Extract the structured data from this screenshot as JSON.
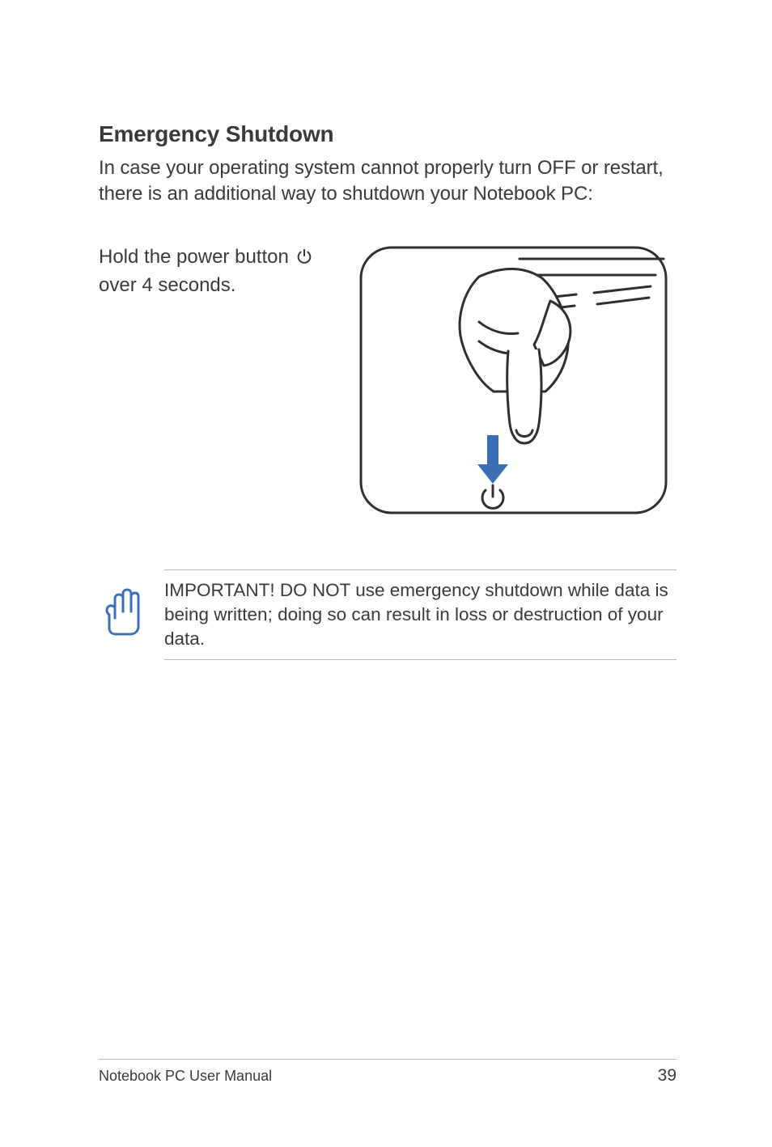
{
  "heading": "Emergency Shutdown",
  "intro": "In case your operating system cannot properly turn OFF or restart, there is an additional way to shutdown your Notebook PC:",
  "instruction_pre": "Hold the power button ",
  "instruction_post": " over 4 seconds.",
  "note": "IMPORTANT!  DO NOT use emergency shutdown while data is being written; doing so can result in loss or destruction of your data.",
  "footer_title": "Notebook PC User Manual",
  "page_number": "39"
}
